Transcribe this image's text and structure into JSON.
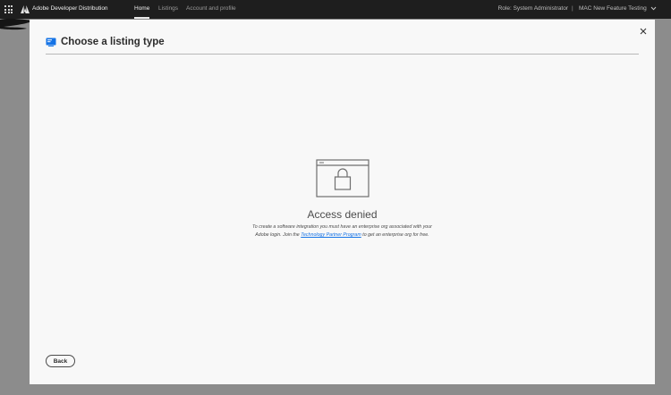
{
  "topbar": {
    "brand": "Adobe Developer Distribution",
    "nav": [
      {
        "label": "Home",
        "active": true
      },
      {
        "label": "Listings",
        "active": false
      },
      {
        "label": "Account and profile",
        "active": false
      }
    ],
    "role": "Role: System Administrator",
    "separator": "|",
    "org": "MAC New Feature Testing"
  },
  "modal": {
    "title": "Choose a listing type",
    "denied": {
      "title": "Access denied",
      "line1": "To create a software integration you must have an enterprise org associated with your",
      "line2_before": "Adobe login. Join the ",
      "link": "Technology Partner Program",
      "line2_after": " to get an enterprise org for free."
    },
    "back_label": "Back"
  },
  "colors": {
    "topbar_bg": "#1e1e1e",
    "overlay": "#8c8c8c",
    "modal_bg": "#f8f8f8",
    "link": "#1473e6",
    "header_icon": "#1473e6"
  },
  "icons": {
    "app_switcher": "grid-icon",
    "logo": "adobe-logo-icon",
    "org_menu": "chevron-down-icon",
    "modal_header": "desktop-app-icon",
    "close": "close-icon",
    "illustration": "locked-window-icon"
  }
}
